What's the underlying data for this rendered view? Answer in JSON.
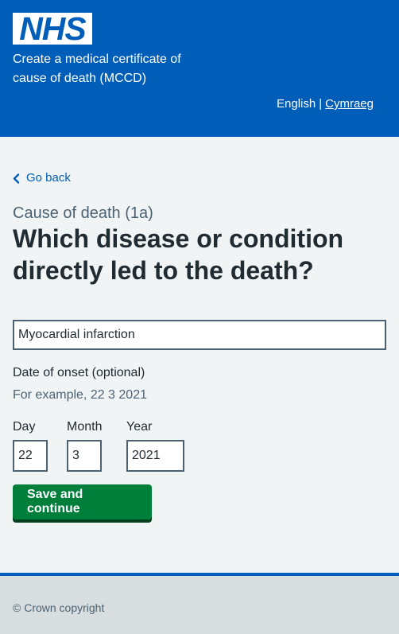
{
  "header": {
    "logo_text": "NHS",
    "service_name": "Create a medical certificate of cause of death (MCCD)",
    "language": {
      "current": "English",
      "separator": "|",
      "other": "Cymraeg"
    }
  },
  "back_link": "Go back",
  "caption": "Cause of death (1a)",
  "heading": "Which disease or condition directly led to the death?",
  "condition_input": {
    "value": "Myocardial infarction"
  },
  "onset": {
    "label": "Date of onset (optional)",
    "hint": "For example, 22 3 2021",
    "day": {
      "label": "Day",
      "value": "22"
    },
    "month": {
      "label": "Month",
      "value": "3"
    },
    "year": {
      "label": "Year",
      "value": "2021"
    }
  },
  "submit_label": "Save and continue",
  "footer": {
    "copyright": "© Crown copyright"
  },
  "colors": {
    "nhs_blue": "#005eb8",
    "button_green": "#007f3b",
    "background": "#f0f4f5"
  }
}
